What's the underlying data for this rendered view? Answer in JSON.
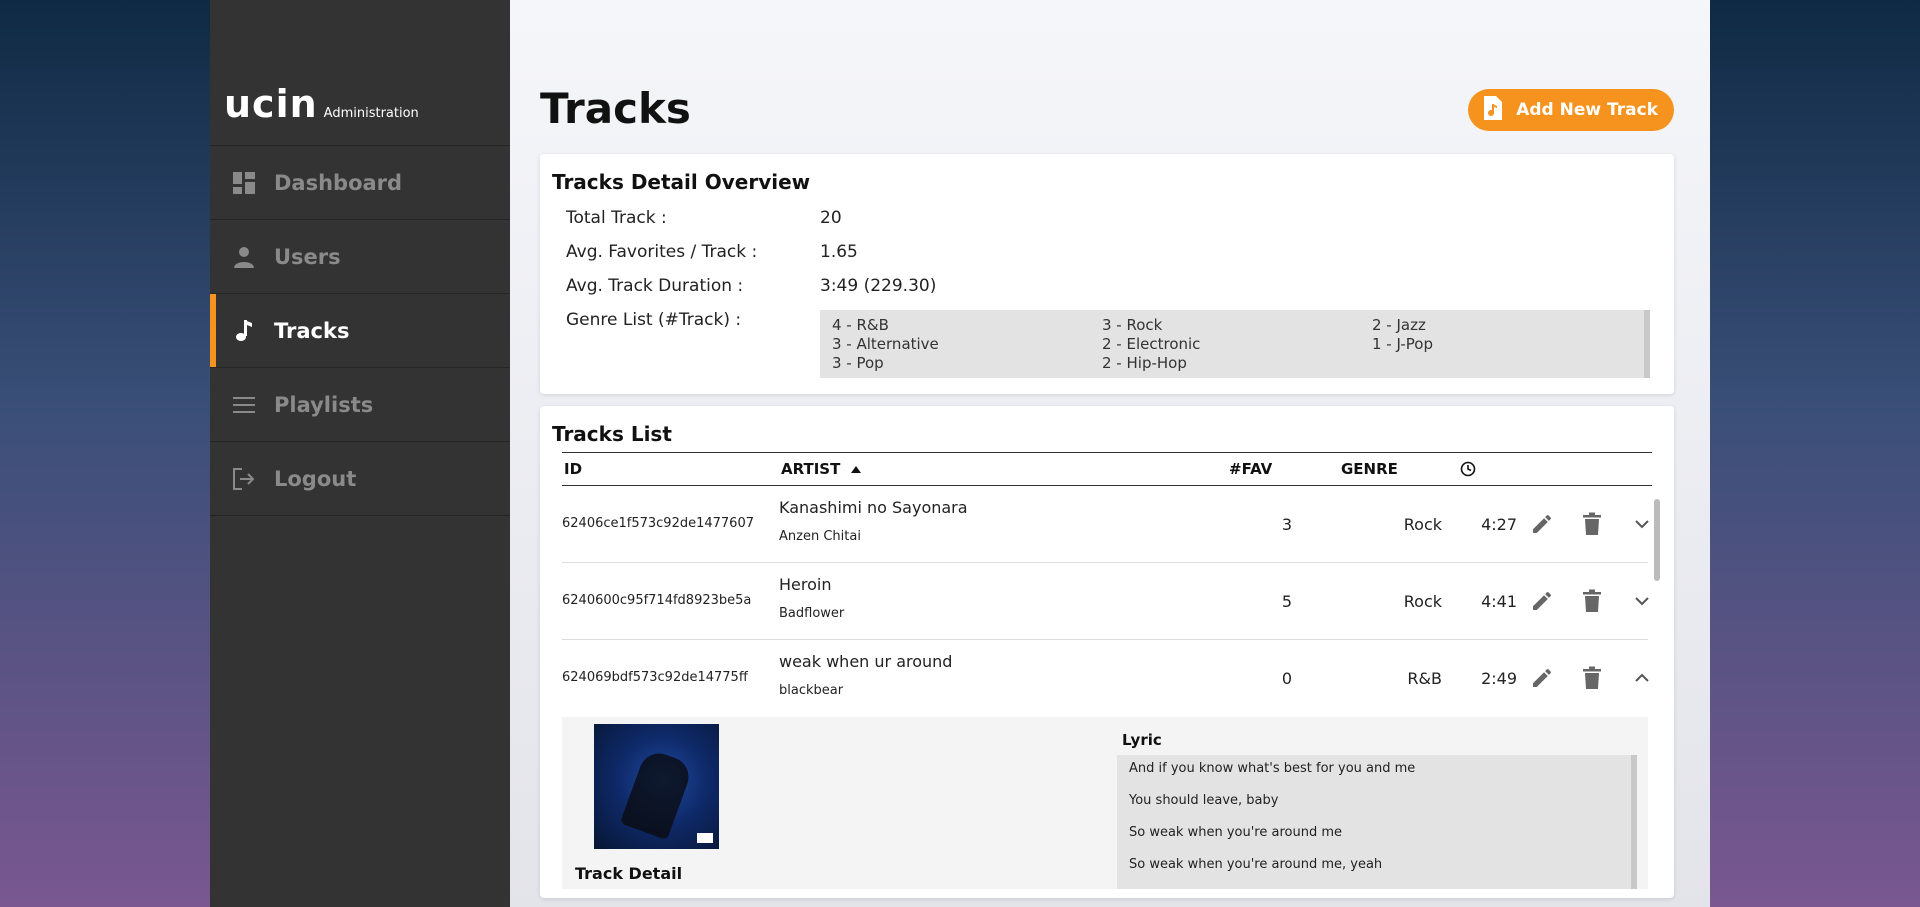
{
  "brand": {
    "logo": "ucin",
    "subtitle": "Administration"
  },
  "nav": [
    {
      "label": "Dashboard",
      "icon": "dashboard-icon",
      "active": false
    },
    {
      "label": "Users",
      "icon": "user-icon",
      "active": false
    },
    {
      "label": "Tracks",
      "icon": "music-note-icon",
      "active": true
    },
    {
      "label": "Playlists",
      "icon": "list-icon",
      "active": false
    },
    {
      "label": "Logout",
      "icon": "logout-icon",
      "active": false
    }
  ],
  "page": {
    "title": "Tracks",
    "add_button": "Add New Track"
  },
  "overview": {
    "title": "Tracks Detail Overview",
    "total_label": "Total Track :",
    "total_value": "20",
    "fav_label": "Avg. Favorites / Track :",
    "fav_value": "1.65",
    "dur_label": "Avg. Track Duration :",
    "dur_value": "3:49 (229.30)",
    "genre_label": "Genre List (#Track) :",
    "genres": [
      "4 - R&B",
      "3 - Rock",
      "2 - Jazz",
      "3 - Alternative",
      "2 - Electronic",
      "1 - J-Pop",
      "3 - Pop",
      "2 - Hip-Hop"
    ]
  },
  "tracks": {
    "title": "Tracks List",
    "headers": {
      "id": "ID",
      "artist": "ARTIST",
      "fav": "#FAV",
      "genre": "GENRE"
    },
    "rows": [
      {
        "id": "62406ce1f573c92de1477607",
        "title": "Kanashimi no Sayonara",
        "artist": "Anzen Chitai",
        "fav": "3",
        "genre": "Rock",
        "duration": "4:27",
        "expanded": false
      },
      {
        "id": "6240600c95f714fd8923be5a",
        "title": "Heroin",
        "artist": "Badflower",
        "fav": "5",
        "genre": "Rock",
        "duration": "4:41",
        "expanded": false
      },
      {
        "id": "624069bdf573c92de14775ff",
        "title": "weak when ur around",
        "artist": "blackbear",
        "fav": "0",
        "genre": "R&B",
        "duration": "2:49",
        "expanded": true
      }
    ],
    "detail": {
      "title": "Track Detail",
      "lyric_title": "Lyric",
      "lyrics": [
        "And if you know what's best for you and me",
        "You should leave, baby",
        "So weak when you're around me",
        "So weak when you're around me, yeah"
      ]
    }
  },
  "colors": {
    "accent": "#f6931e",
    "sidebar": "#333333"
  }
}
